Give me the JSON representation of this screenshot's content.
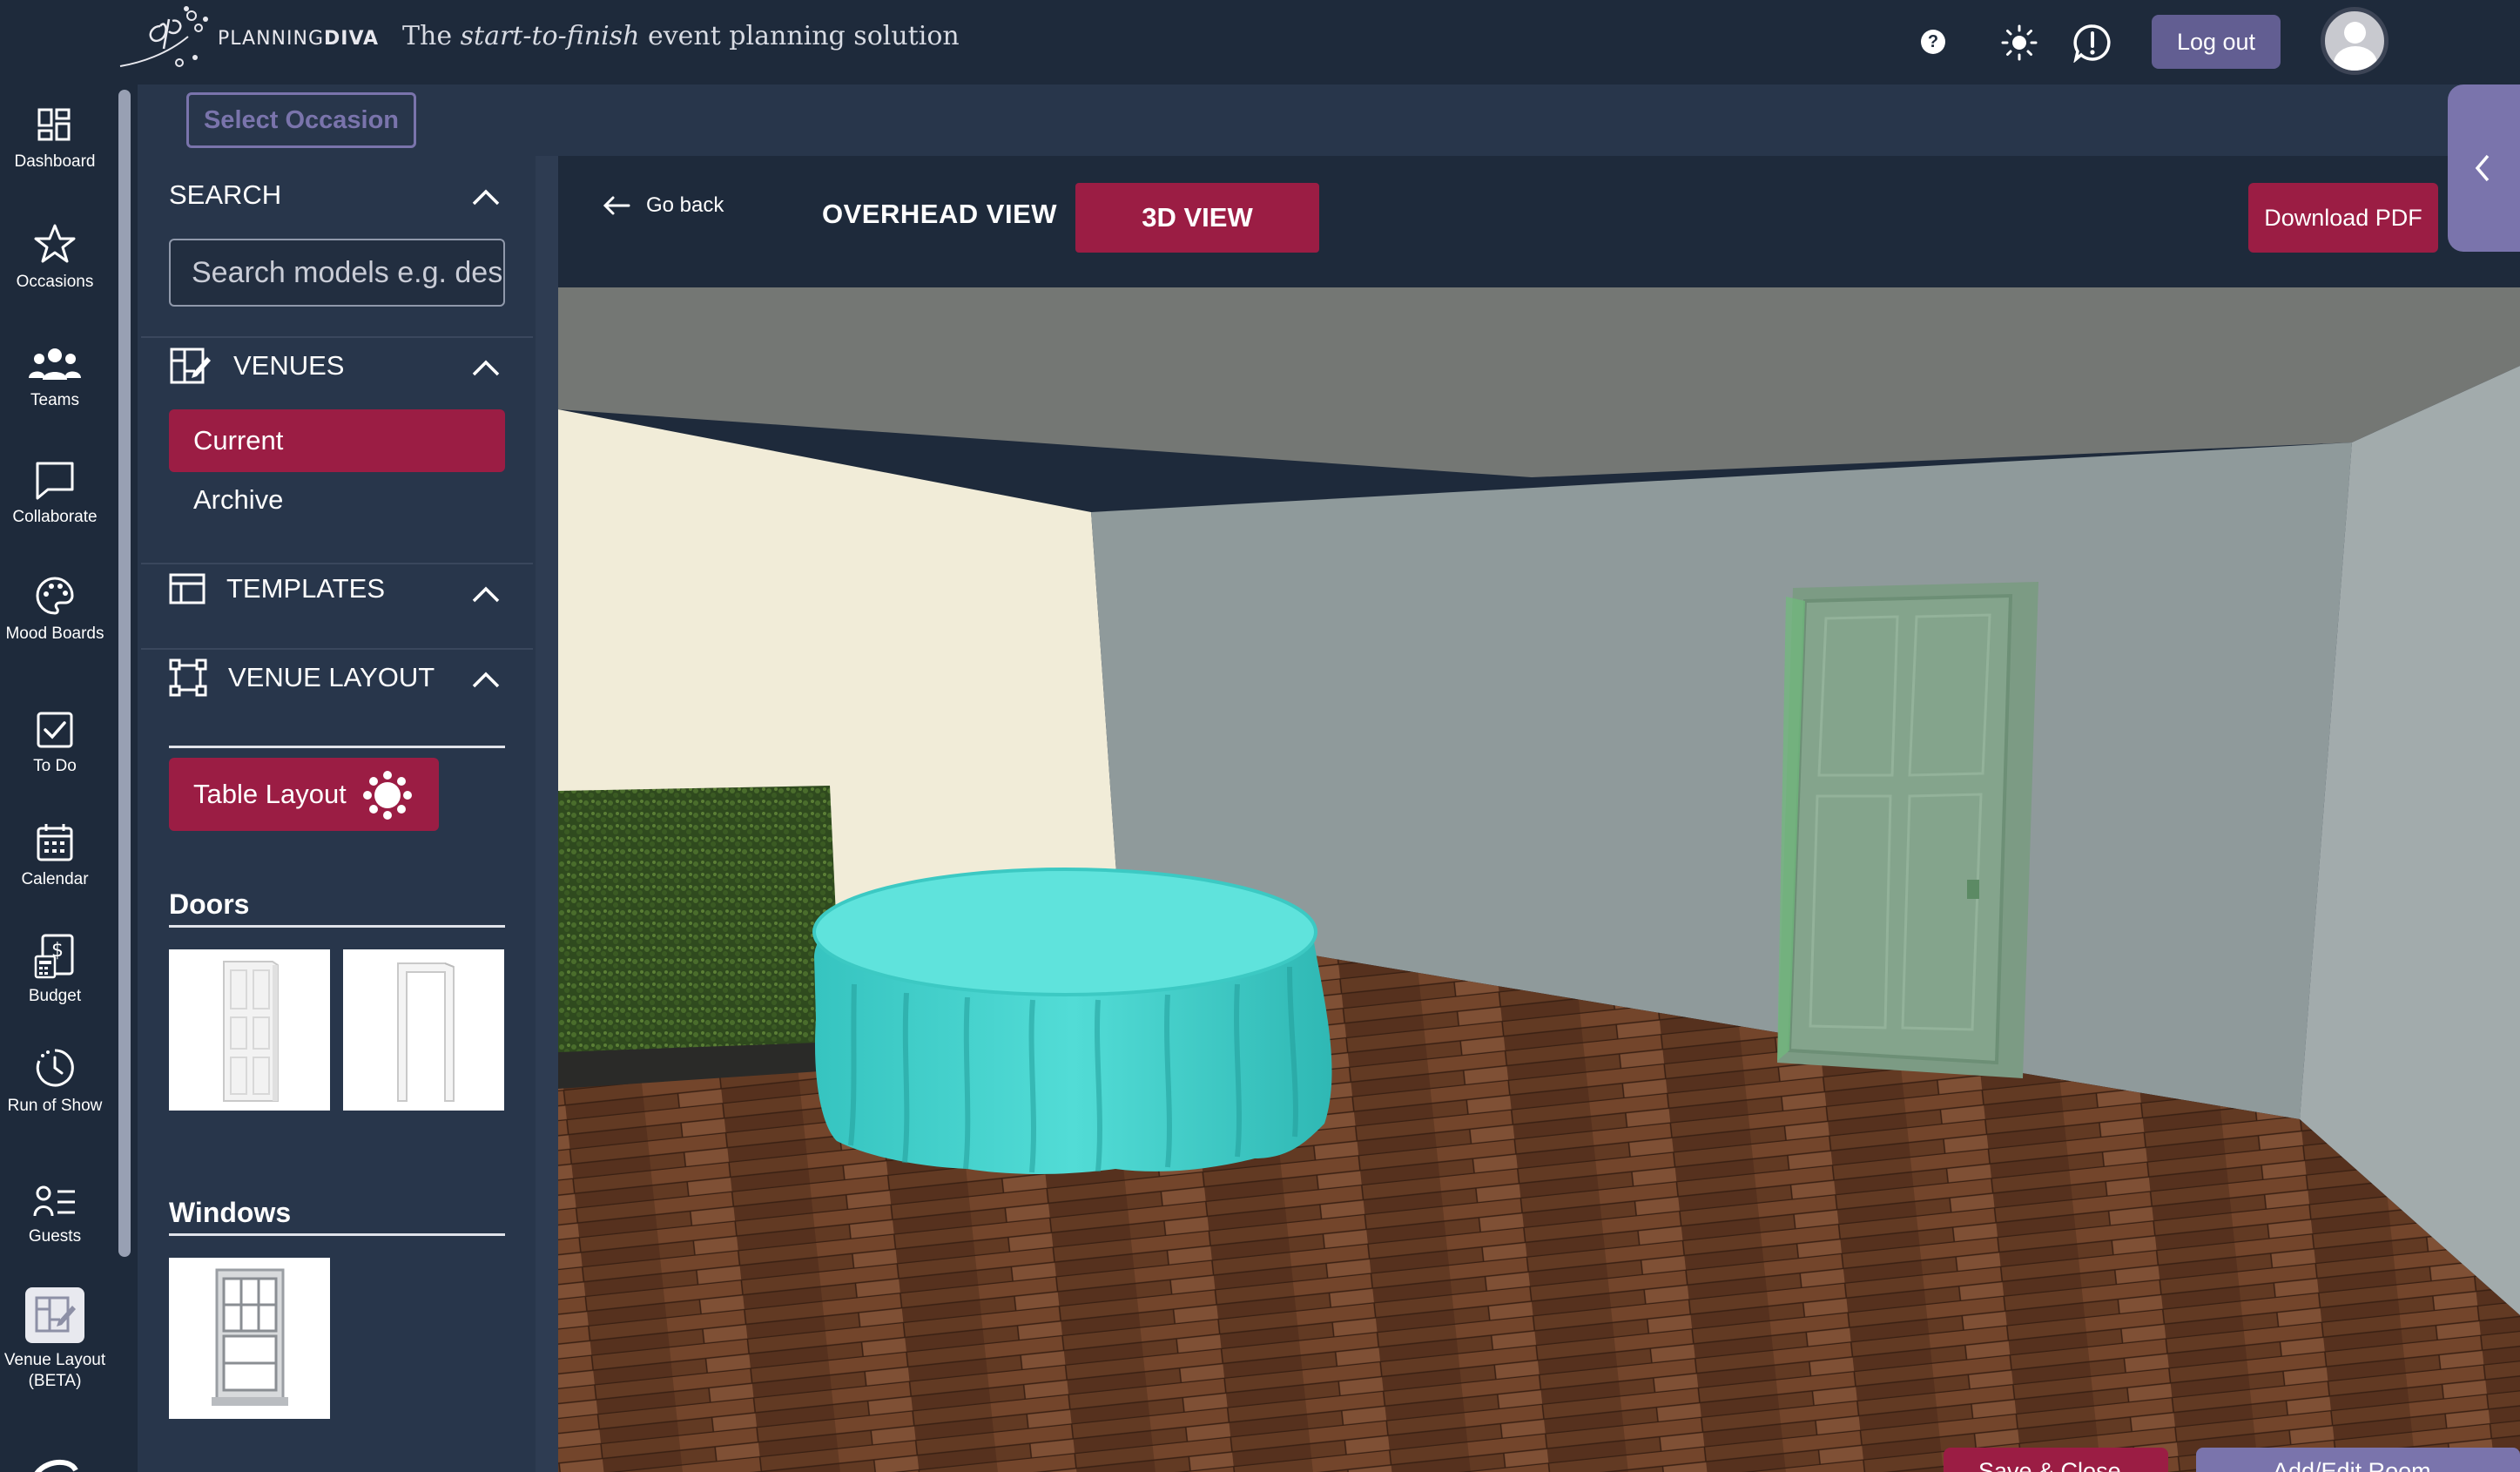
{
  "header": {
    "brand": "PLANNINGDIVA",
    "brand_light": "PLANNING",
    "brand_bold": "DIVA",
    "tagline_prefix": "The ",
    "tagline_italic": "start-to-finish",
    "tagline_suffix": " event planning solution",
    "logout_label": "Log out",
    "help_glyph": "?"
  },
  "nav": {
    "items": [
      {
        "label": "Dashboard",
        "icon": "dashboard-icon"
      },
      {
        "label": "Occasions",
        "icon": "star-icon"
      },
      {
        "label": "Teams",
        "icon": "users-icon"
      },
      {
        "label": "Collaborate",
        "icon": "chat-icon"
      },
      {
        "label": "Mood Boards",
        "icon": "palette-icon"
      },
      {
        "label": "To Do",
        "icon": "checkbox-icon"
      },
      {
        "label": "Calendar",
        "icon": "calendar-icon"
      },
      {
        "label": "Budget",
        "icon": "budget-icon"
      },
      {
        "label": "Run of Show",
        "icon": "clock-icon"
      },
      {
        "label": "Guests",
        "icon": "guest-list-icon"
      },
      {
        "label": "Venue Layout (BETA)",
        "icon": "venue-layout-icon"
      }
    ],
    "active": "Venue Layout (BETA)"
  },
  "occasion": {
    "select_label": "Select Occasion"
  },
  "sidebar": {
    "search_title": "SEARCH",
    "search_placeholder": "Search models e.g. desk",
    "venues_title": "VENUES",
    "venues_current": "Current",
    "venues_archive": "Archive",
    "templates_title": "TEMPLATES",
    "venue_layout_title": "VENUE LAYOUT",
    "table_layout_label": "Table Layout",
    "doors_title": "Doors",
    "windows_title": "Windows"
  },
  "view": {
    "go_back": "Go back",
    "overhead_tab": "OVERHEAD VIEW",
    "threed_tab": "3D VIEW",
    "active_tab": "3D VIEW",
    "download_pdf": "Download PDF"
  },
  "bottom": {
    "save_label": "Save & Close",
    "add_edit_label": "Add/Edit Room"
  },
  "colors": {
    "navy": "#1e2a3b",
    "panel": "#28364b",
    "accent_crimson": "#9b1d44",
    "accent_purple": "#7a74ac",
    "tablecloth": "#4fd9d4"
  }
}
